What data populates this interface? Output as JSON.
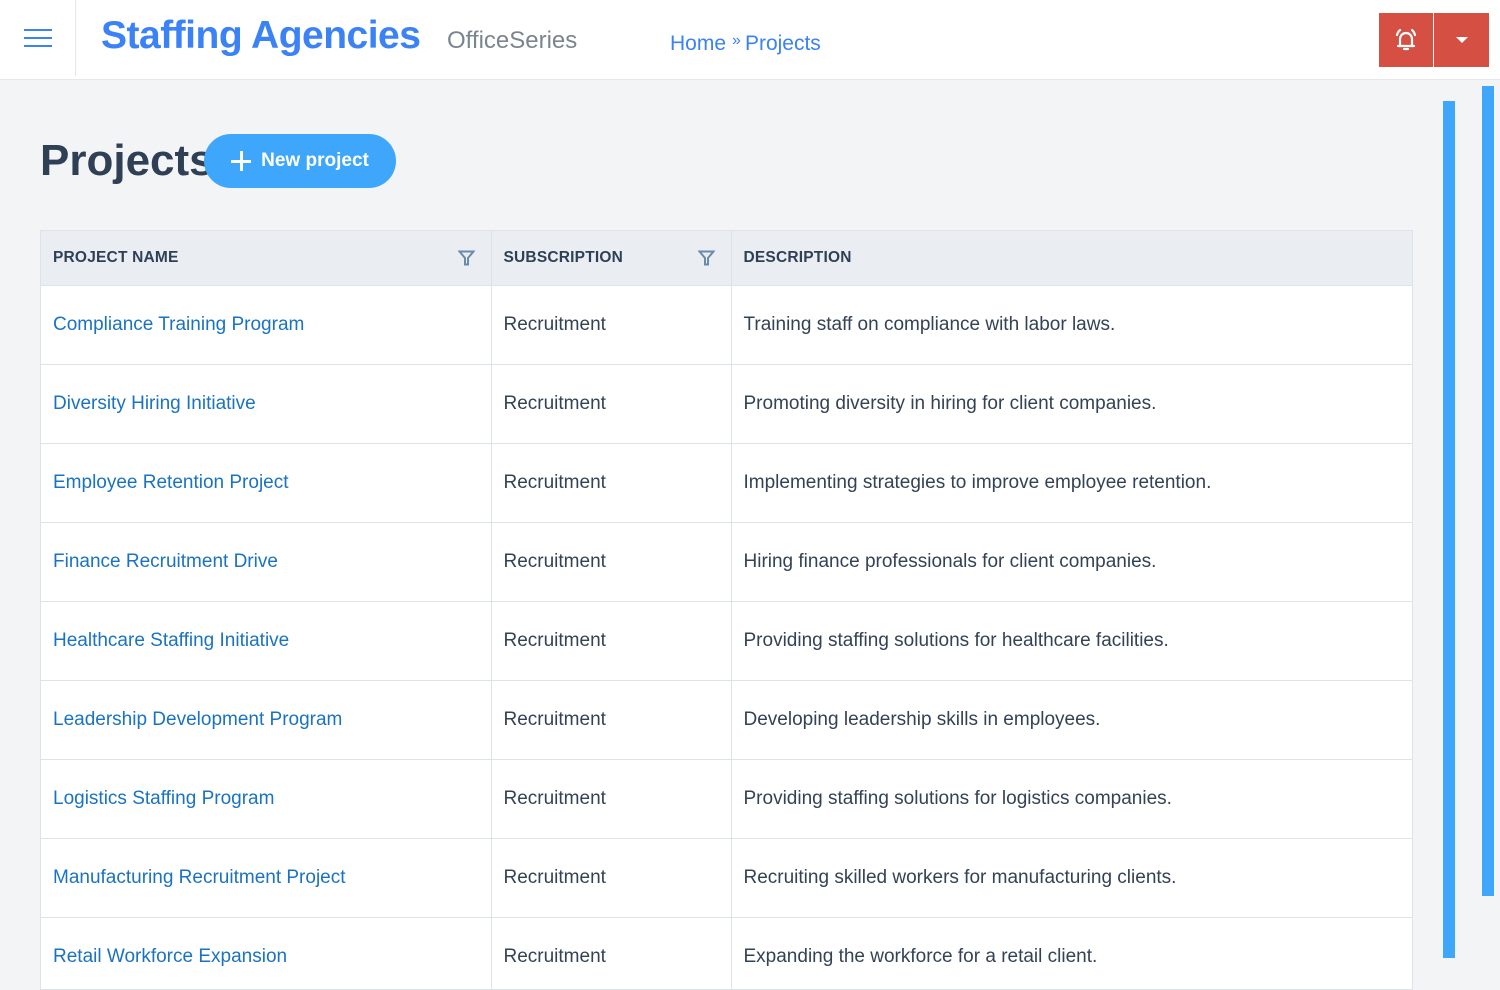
{
  "header": {
    "menu_icon": "hamburger-menu-icon",
    "brand": "Staffing Agencies",
    "subbrand": "OfficeSeries",
    "breadcrumb": [
      {
        "label": "Home"
      },
      {
        "label": "Projects"
      }
    ],
    "breadcrumb_separator": "»",
    "actions": {
      "alert_icon": "bell-alarm-icon",
      "dropdown_icon": "caret-down-icon",
      "accent": "#d64f43"
    }
  },
  "page": {
    "title": "Projects",
    "new_button_label": "New project",
    "new_button_icon": "plus-icon",
    "accent": "#3ea6fb"
  },
  "table": {
    "columns": [
      {
        "label": "PROJECT NAME",
        "filter": true
      },
      {
        "label": "SUBSCRIPTION",
        "filter": true
      },
      {
        "label": "DESCRIPTION",
        "filter": false
      }
    ],
    "rows": [
      {
        "name": "Compliance Training Program",
        "subscription": "Recruitment",
        "description": "Training staff on compliance with labor laws."
      },
      {
        "name": "Diversity Hiring Initiative",
        "subscription": "Recruitment",
        "description": "Promoting diversity in hiring for client companies."
      },
      {
        "name": "Employee Retention Project",
        "subscription": "Recruitment",
        "description": "Implementing strategies to improve employee retention."
      },
      {
        "name": "Finance Recruitment Drive",
        "subscription": "Recruitment",
        "description": "Hiring finance professionals for client companies."
      },
      {
        "name": "Healthcare Staffing Initiative",
        "subscription": "Recruitment",
        "description": "Providing staffing solutions for healthcare facilities."
      },
      {
        "name": "Leadership Development Program",
        "subscription": "Recruitment",
        "description": "Developing leadership skills in employees."
      },
      {
        "name": "Logistics Staffing Program",
        "subscription": "Recruitment",
        "description": "Providing staffing solutions for logistics companies."
      },
      {
        "name": "Manufacturing Recruitment Project",
        "subscription": "Recruitment",
        "description": "Recruiting skilled workers for manufacturing clients."
      },
      {
        "name": "Retail Workforce Expansion",
        "subscription": "Recruitment",
        "description": "Expanding the workforce for a retail client."
      }
    ]
  }
}
